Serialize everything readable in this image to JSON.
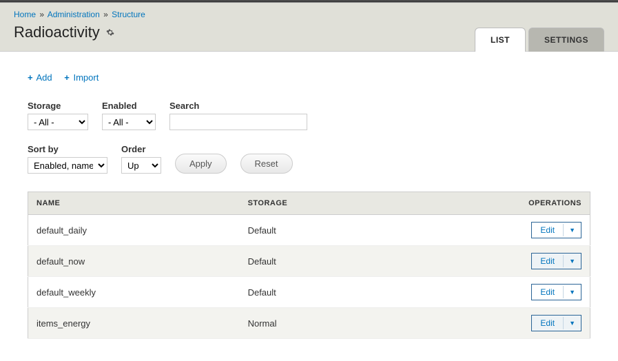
{
  "breadcrumb": {
    "home": "Home",
    "administration": "Administration",
    "structure": "Structure",
    "sep": "»"
  },
  "page_title": "Radioactivity",
  "tabs": {
    "list": "LIST",
    "settings": "SETTINGS"
  },
  "actions": {
    "add": "Add",
    "import": "Import"
  },
  "filters": {
    "storage_label": "Storage",
    "storage_value": "- All -",
    "enabled_label": "Enabled",
    "enabled_value": "- All -",
    "search_label": "Search",
    "search_value": "",
    "sortby_label": "Sort by",
    "sortby_value": "Enabled, name",
    "order_label": "Order",
    "order_value": "Up",
    "apply": "Apply",
    "reset": "Reset"
  },
  "table": {
    "headers": {
      "name": "Name",
      "storage": "Storage",
      "operations": "Operations"
    },
    "edit_label": "Edit",
    "rows": [
      {
        "name": "default_daily",
        "storage": "Default"
      },
      {
        "name": "default_now",
        "storage": "Default"
      },
      {
        "name": "default_weekly",
        "storage": "Default"
      },
      {
        "name": "items_energy",
        "storage": "Normal"
      }
    ]
  }
}
